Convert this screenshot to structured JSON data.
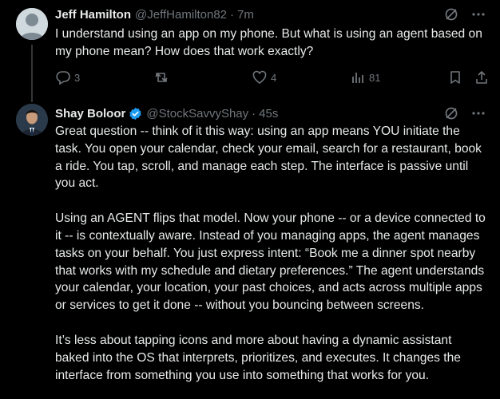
{
  "tweets": [
    {
      "name": "Jeff Hamilton",
      "handle": "@JeffHamilton82",
      "time": "7m",
      "text": "I understand using an app on my phone. But what is using an agent based on my phone mean? How does that work exactly?",
      "replies": "3",
      "likes": "4",
      "views": "81"
    },
    {
      "name": "Shay Boloor",
      "handle": "@StockSavvyShay",
      "time": "45s",
      "paragraphs": [
        "Great question -- think of it this way: using an app means YOU initiate the task. You open your calendar, check your email, search for a restaurant, book a ride. You tap, scroll, and manage each step. The interface is passive until you act.",
        "Using an AGENT flips that model. Now your phone -- or a device connected to it -- is contextually aware. Instead of you managing apps, the agent manages tasks on your behalf. You just express intent: “Book me a dinner spot nearby that works with my schedule and dietary preferences.” The agent understands your calendar, your location, your past choices, and acts across multiple apps or services to get it done -- without you bouncing between screens.",
        "It’s less about tapping icons and more about having a dynamic assistant baked into the OS that interprets, prioritizes, and executes. It changes the interface from something you use into something that works for you."
      ]
    }
  ],
  "icons": {
    "grok": "grok-icon",
    "more": "more-icon",
    "reply": "reply-icon",
    "retweet": "retweet-icon",
    "like": "like-icon",
    "views": "views-icon",
    "bookmark": "bookmark-icon",
    "share": "share-icon",
    "verified": "verified-badge-icon"
  },
  "colors": {
    "background": "#000000",
    "text": "#e7e9ea",
    "secondary": "#71767b",
    "verified": "#1d9bf0"
  }
}
